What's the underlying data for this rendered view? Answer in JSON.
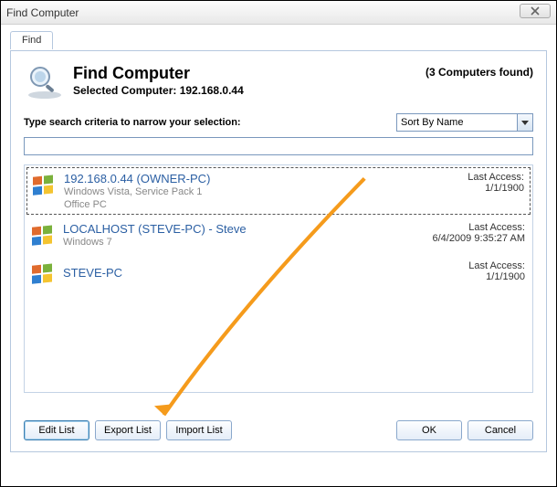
{
  "window": {
    "title": "Find Computer"
  },
  "tab": {
    "label": "Find"
  },
  "header": {
    "title": "Find Computer",
    "selected_prefix": "Selected Computer: ",
    "selected_value": "192.168.0.44",
    "found_text": "(3 Computers found)"
  },
  "criteria_label": "Type search criteria to narrow your selection:",
  "sort": {
    "selected": "Sort By Name"
  },
  "search": {
    "value": ""
  },
  "last_access_label": "Last Access:",
  "rows": [
    {
      "name": "192.168.0.44 (OWNER-PC)",
      "meta": "Windows Vista, Service Pack 1",
      "tag": "Office PC",
      "date": "1/1/1900",
      "selected": true
    },
    {
      "name": "LOCALHOST (STEVE-PC) - Steve",
      "meta": "Windows 7",
      "tag": "",
      "date": "6/4/2009 9:35:27 AM",
      "selected": false
    },
    {
      "name": "STEVE-PC",
      "meta": "",
      "tag": "",
      "date": "1/1/1900",
      "selected": false
    }
  ],
  "buttons": {
    "edit": "Edit List",
    "export": "Export List",
    "import": "Import List",
    "ok": "OK",
    "cancel": "Cancel"
  }
}
